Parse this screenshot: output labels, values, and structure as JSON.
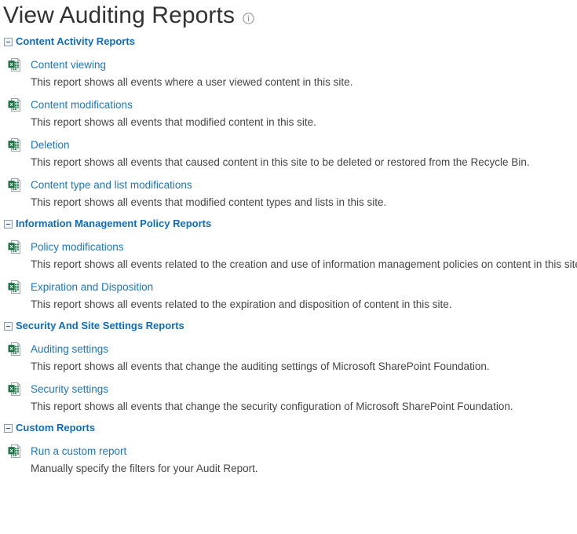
{
  "page": {
    "title": "View Auditing Reports",
    "info_icon": "info-circle-icon"
  },
  "colors": {
    "link": "#1e76bd",
    "section_header": "#0f6cbd",
    "description": "#454545",
    "title": "#333333",
    "excel_green": "#1e7145"
  },
  "sections": [
    {
      "id": "content-activity-reports",
      "title": "Content Activity Reports",
      "collapse_icon": "collapse-minus-icon",
      "reports": [
        {
          "icon": "excel-report-icon",
          "label": "Content viewing",
          "description": "This report shows all events where a user viewed content in this site."
        },
        {
          "icon": "excel-report-icon",
          "label": "Content modifications",
          "description": "This report shows all events that modified content in this site."
        },
        {
          "icon": "excel-report-icon",
          "label": "Deletion",
          "description": "This report shows all events that caused content in this site to be deleted or restored from the Recycle Bin."
        },
        {
          "icon": "excel-report-icon",
          "label": "Content type and list modifications",
          "description": "This report shows all events that modified content types and lists in this site."
        }
      ]
    },
    {
      "id": "information-management-policy-reports",
      "title": "Information Management Policy Reports",
      "collapse_icon": "collapse-minus-icon",
      "reports": [
        {
          "icon": "excel-report-icon",
          "label": "Policy modifications",
          "description": "This report shows all events related to the creation and use of information management policies on content in this site."
        },
        {
          "icon": "excel-report-icon",
          "label": "Expiration and Disposition",
          "description": "This report shows all events related to the expiration and disposition of content in this site."
        }
      ]
    },
    {
      "id": "security-and-site-settings-reports",
      "title": "Security And Site Settings Reports",
      "collapse_icon": "collapse-minus-icon",
      "reports": [
        {
          "icon": "excel-report-icon",
          "label": "Auditing settings",
          "description": "This report shows all events that change the auditing settings of Microsoft SharePoint Foundation."
        },
        {
          "icon": "excel-report-icon",
          "label": "Security settings",
          "description": "This report shows all events that change the security configuration of Microsoft SharePoint Foundation."
        }
      ]
    },
    {
      "id": "custom-reports",
      "title": "Custom Reports",
      "collapse_icon": "collapse-minus-icon",
      "reports": [
        {
          "icon": "excel-report-icon",
          "label": "Run a custom report",
          "description": "Manually specify the filters for your Audit Report."
        }
      ]
    }
  ]
}
